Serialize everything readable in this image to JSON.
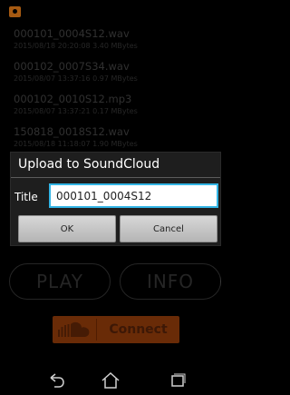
{
  "status_bar": {
    "notification_icon": "soundcloud-notification-icon"
  },
  "files": [
    {
      "name": "000101_0004S12.wav",
      "meta": "2015/08/18 20:20:08 3.40 MBytes"
    },
    {
      "name": "000102_0007S34.wav",
      "meta": "2015/08/07 13:37:16 0.97 MBytes"
    },
    {
      "name": "000102_0010S12.mp3",
      "meta": "2015/08/07 13:37:21 0.17 MBytes"
    },
    {
      "name": "150818_0018S12.wav",
      "meta": "2015/08/18 11:18:07 1.90 MBytes"
    }
  ],
  "dialog": {
    "title": "Upload to SoundCloud",
    "field_label": "Title",
    "field_value": "000101_0004S12",
    "ok_label": "OK",
    "cancel_label": "Cancel"
  },
  "main": {
    "play_label": "PLAY",
    "info_label": "INFO",
    "connect_label": "Connect"
  },
  "colors": {
    "accent": "#33b5e5",
    "soundcloud": "#ff5500"
  },
  "nav": {
    "back_icon": "back-icon",
    "home_icon": "home-icon",
    "recent_icon": "recent-apps-icon"
  }
}
